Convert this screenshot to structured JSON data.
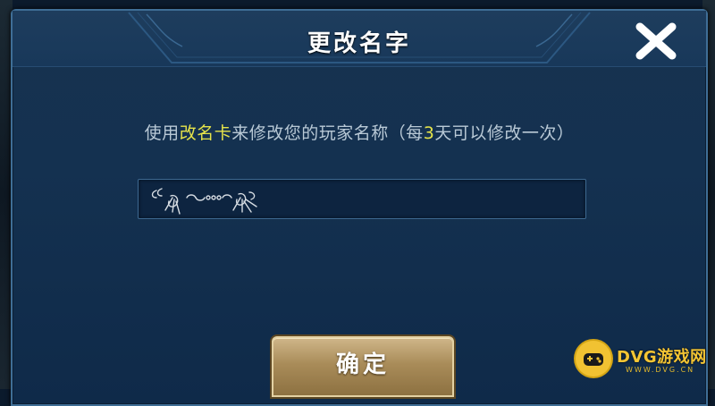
{
  "dialog": {
    "title": "更改名字",
    "close_icon": "close-icon"
  },
  "info": {
    "prefix": "使用",
    "card_name": "改名卡",
    "middle": "来修改您的玩家名称（每",
    "days": "3",
    "suffix": "天可以修改一次）"
  },
  "name_input": {
    "value": "",
    "decoration": "ornamental-name-glyph"
  },
  "confirm_button": {
    "label": "确定"
  },
  "watermark": {
    "brand": "DVG游戏网",
    "sub": "WWW.DVG.CN",
    "icon": "gamepad-icon"
  },
  "colors": {
    "highlight": "#e6e44a",
    "info_text": "#b9c9d6",
    "button_gold": "#a98c59",
    "dialog_border": "#3f6e96",
    "watermark": "#f4c534"
  }
}
